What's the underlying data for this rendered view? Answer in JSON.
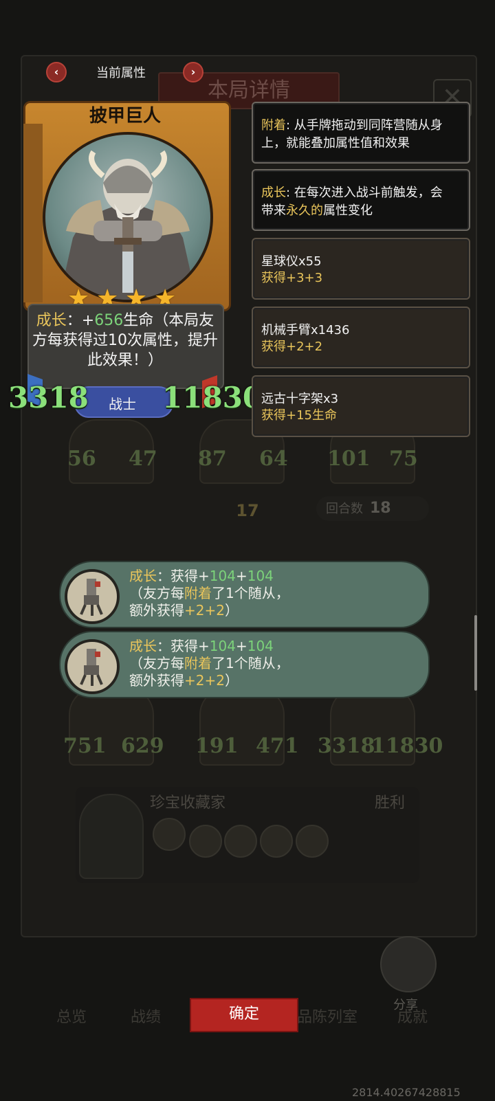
{
  "header": {
    "current_attribute_label": "当前属性",
    "background_title": "本局详情"
  },
  "card": {
    "name": "披甲巨人",
    "stars": 4,
    "desc_prefix": "成长",
    "desc_colon": "：",
    "desc_plus": "+",
    "desc_value": "656",
    "desc_rest": "生命（本局友方每获得过10次属性，提升此效果！）",
    "class_label": "战士",
    "attack": "3318",
    "health": "11830"
  },
  "info_panels": {
    "attach": {
      "keyword": "附着",
      "text": ": 从手牌拖动到同阵营随从身",
      "line2": "上，就能叠加属性值和效果"
    },
    "growth": {
      "keyword": "成长",
      "text": ": 在每次进入战斗前触发，会",
      "line2_pre": "带来",
      "line2_highlight": "永久的",
      "line2_post": "属性变化"
    },
    "items": [
      {
        "name": "星球仪x55",
        "gain": "获得+3+3"
      },
      {
        "name": "机械手臂x1436",
        "gain": "获得+2+2"
      },
      {
        "name": "远古十字架x3",
        "gain": "获得+15生命"
      }
    ]
  },
  "toasts": [
    {
      "keyword": "成长",
      "gain_pre": "：获得+",
      "v1": "104",
      "plus": "+",
      "v2": "104",
      "line2_pre": "（友方每",
      "line2_kw": "附着",
      "line2_post": "了1个随从，",
      "line3_pre": "额外获得",
      "line3_val": "+2+2",
      "line3_post": "）"
    },
    {
      "keyword": "成长",
      "gain_pre": "：获得+",
      "v1": "104",
      "plus": "+",
      "v2": "104",
      "line2_pre": "（友方每",
      "line2_kw": "附着",
      "line2_post": "了1个随从，",
      "line3_pre": "额外获得",
      "line3_val": "+2+2",
      "line3_post": "）"
    }
  ],
  "background": {
    "row1_stats": [
      [
        "56",
        "47"
      ],
      [
        "87",
        "64"
      ],
      [
        "101",
        "75"
      ]
    ],
    "level": "17",
    "rounds_label": "回合数",
    "rounds_value": "18",
    "row2_stats": [
      [
        "751",
        "629"
      ],
      [
        "191",
        "471"
      ],
      [
        "3318",
        "11830"
      ]
    ],
    "opponent_name": "珍宝收藏家",
    "opponent_result": "胜利",
    "share_label": "分享",
    "tabs": [
      "总览",
      "战绩",
      "品陈列室",
      "成就"
    ]
  },
  "confirm_label": "确定",
  "version": "2814.40267428815",
  "colors": {
    "accent_green": "#7cd37a",
    "keyword_yellow": "#e9c55b",
    "confirm_red": "#b42521",
    "toast_bg": "#577367"
  }
}
